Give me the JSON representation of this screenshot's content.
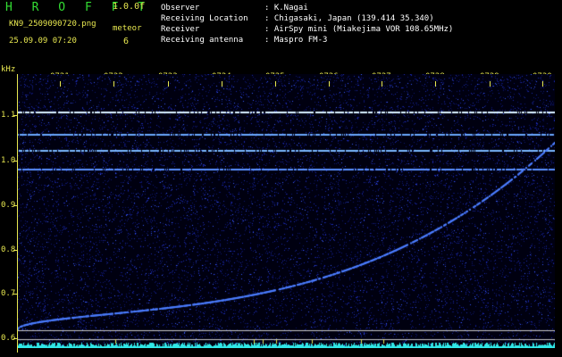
{
  "header": {
    "app_title": "H R O F F T",
    "app_version": "1.0.0f",
    "file_name": "KN9_2509090720.png",
    "timestamp": "25.09.09 07:20",
    "meteor_label": "meteor",
    "meteor_count": "6"
  },
  "info": [
    {
      "key": "Observer",
      "value": ": K.Nagai"
    },
    {
      "key": "Receiving Location",
      "value": ": Chigasaki, Japan (139.414 35.340)"
    },
    {
      "key": "Receiver",
      "value": ": AirSpy mini (Miakejima VOR 108.65MHz)"
    },
    {
      "key": "Receiving antenna",
      "value": ": Maspro FM-3"
    }
  ],
  "axes": {
    "y_unit": "kHz",
    "y_ticks": [
      "1.1",
      "1.0",
      "0.9",
      "0.8",
      "0.7",
      "0.6"
    ],
    "x_ticks": [
      "0721",
      "0722",
      "0723",
      "0724",
      "0725",
      "0726",
      "0727",
      "0728",
      "0729",
      "0730"
    ]
  },
  "colors": {
    "background": "#000000",
    "label": "#e8e850",
    "title": "#33dd33",
    "noise": "#1a2a9a",
    "signal": "#4a8cff",
    "strong_signal": "#c8e8ff",
    "baseline": "#30e8e8"
  }
}
